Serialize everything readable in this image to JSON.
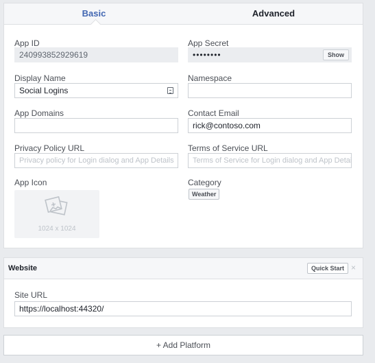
{
  "tabs": {
    "basic": "Basic",
    "advanced": "Advanced"
  },
  "fields": {
    "app_id": {
      "label": "App ID",
      "value": "240993852929619"
    },
    "app_secret": {
      "label": "App Secret",
      "value": "••••••••",
      "show_label": "Show"
    },
    "display_name": {
      "label": "Display Name",
      "value": "Social Logins"
    },
    "namespace": {
      "label": "Namespace",
      "value": ""
    },
    "app_domains": {
      "label": "App Domains",
      "value": ""
    },
    "contact_email": {
      "label": "Contact Email",
      "value": "rick@contoso.com"
    },
    "privacy_policy_url": {
      "label": "Privacy Policy URL",
      "placeholder": "Privacy policy for Login dialog and App Details"
    },
    "terms_of_service_url": {
      "label": "Terms of Service URL",
      "placeholder": "Terms of Service for Login dialog and App Details"
    },
    "app_icon": {
      "label": "App Icon",
      "size": "1024 x 1024"
    },
    "category": {
      "label": "Category",
      "value": "Weather"
    }
  },
  "website": {
    "title": "Website",
    "quick_start": "Quick Start",
    "close": "×",
    "site_url_label": "Site URL",
    "site_url": "https://localhost:44320/"
  },
  "add_platform": "+ Add Platform",
  "colors": {
    "accent": "#4267b2",
    "page_bg": "#e9ebee",
    "border": "#dddfe2"
  },
  "icons": {
    "image_placeholder": "picture-placeholder-icon",
    "contact_card": "contact-card-icon"
  }
}
